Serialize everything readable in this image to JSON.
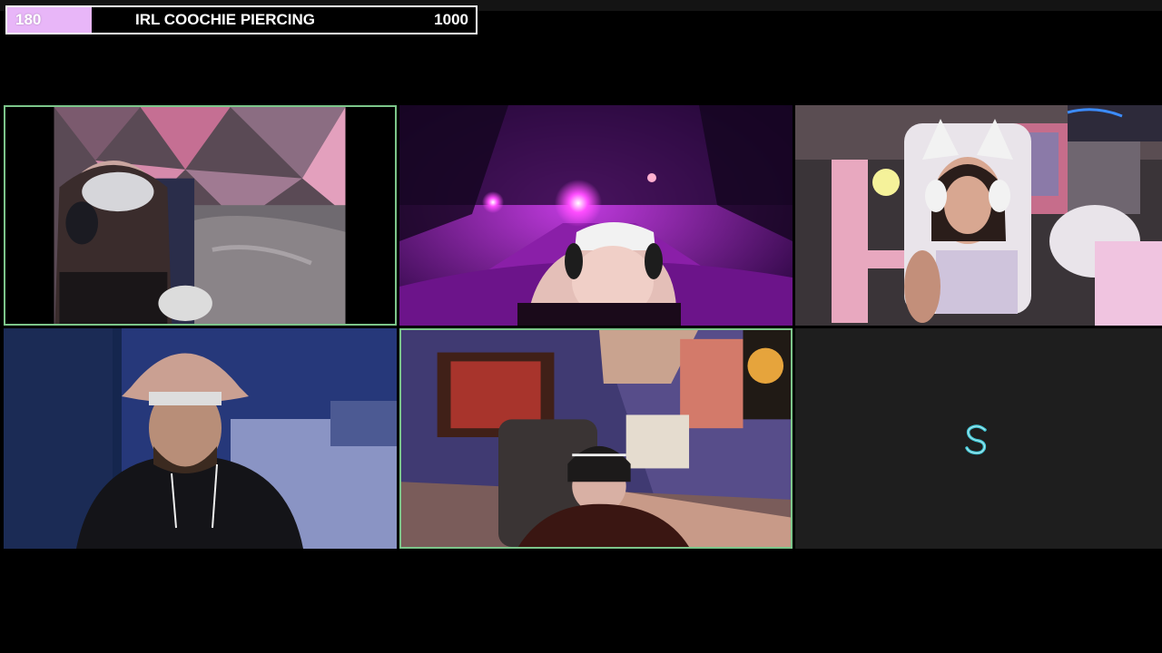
{
  "goal": {
    "current": "180",
    "title": "IRL COOCHIE PIERCING",
    "target": "1000",
    "progress_fraction": 0.18,
    "fill_color": "#e8b6f8"
  },
  "tiles": [
    {
      "id": "tile-1",
      "speaking": true
    },
    {
      "id": "tile-2",
      "speaking": false
    },
    {
      "id": "tile-3",
      "speaking": false
    },
    {
      "id": "tile-4",
      "speaking": false
    },
    {
      "id": "tile-5",
      "speaking": true
    },
    {
      "id": "tile-6",
      "empty": true,
      "icon": "streamer-s-logo-icon"
    }
  ],
  "colors": {
    "speaking_border": "#7cc58a",
    "background": "#000000",
    "empty_tile": "#1e1e1e",
    "logo": "#3fc7d6"
  }
}
